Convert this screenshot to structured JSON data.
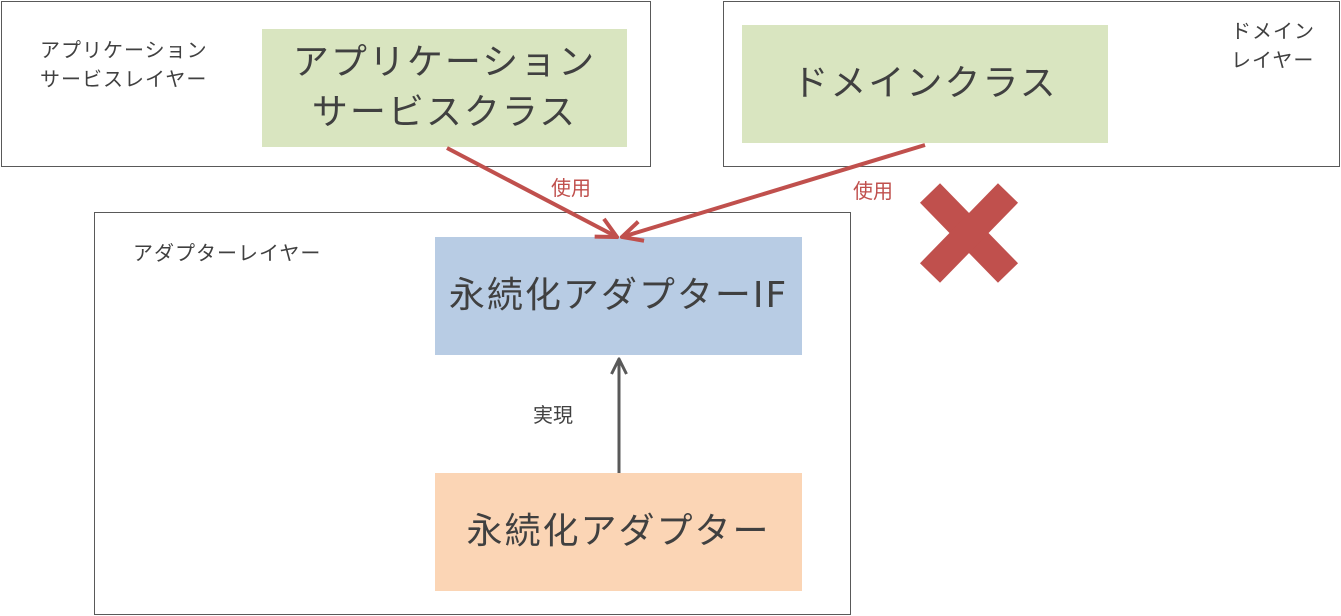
{
  "layers": {
    "app_service": {
      "label": "アプリケーション\nサービスレイヤー"
    },
    "domain": {
      "label": "ドメイン\nレイヤー"
    },
    "adapter": {
      "label": "アダプターレイヤー"
    }
  },
  "nodes": {
    "app_service_class": {
      "label": "アプリケーション\nサービスクラス",
      "color": "#d9e5c0"
    },
    "domain_class": {
      "label": "ドメインクラス",
      "color": "#d9e5c0"
    },
    "persistence_adapter_if": {
      "label": "永続化アダプターIF",
      "color": "#b8cce4"
    },
    "persistence_adapter": {
      "label": "永続化アダプター",
      "color": "#fbd5b5"
    }
  },
  "edges": {
    "app_uses_if": {
      "label": "使用",
      "color": "#c0504d"
    },
    "domain_uses_if": {
      "label": "使用",
      "color": "#c0504d"
    },
    "adapter_implements_if": {
      "label": "実現",
      "color": "#595959"
    }
  },
  "forbidden_mark": {
    "icon": "cross-icon",
    "color": "#c0504d"
  }
}
